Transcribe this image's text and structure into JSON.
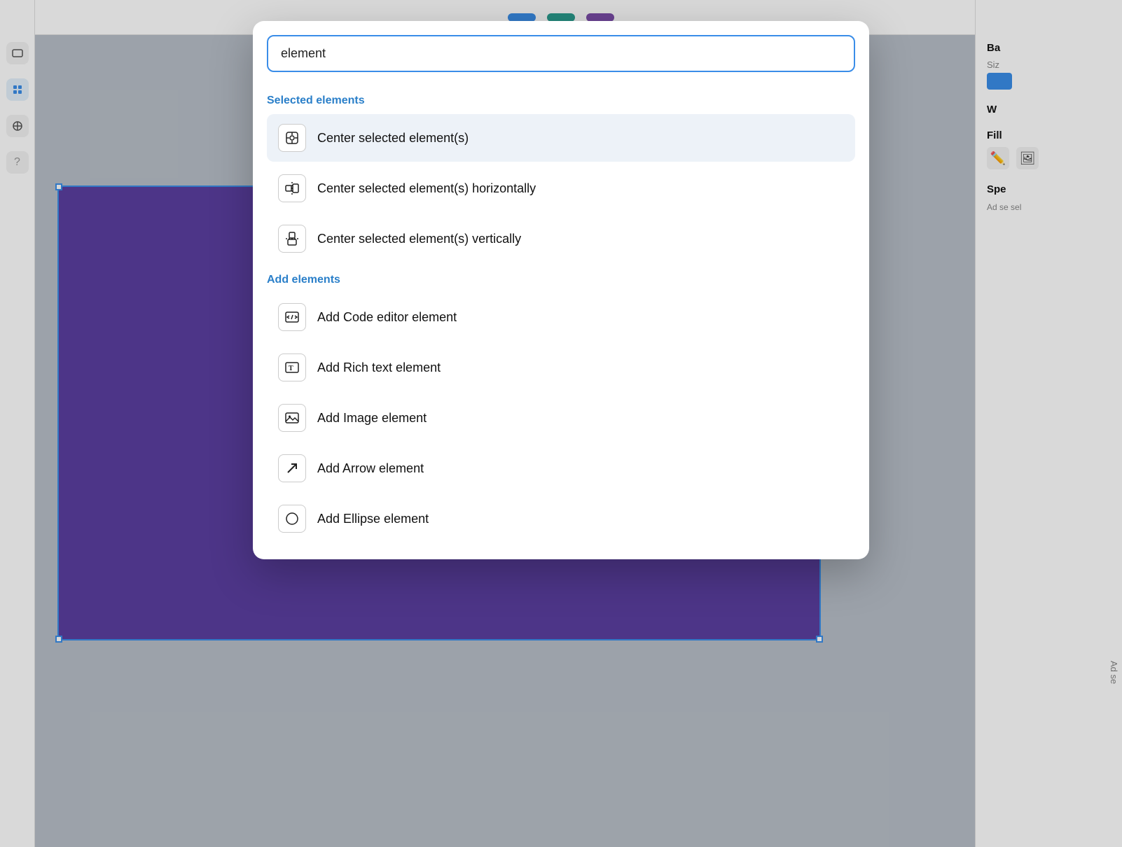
{
  "background": {
    "color": "#b8bfc8"
  },
  "topbar": {
    "buttons": [
      {
        "label": "",
        "style": "blue",
        "name": "top-btn-1"
      },
      {
        "label": "",
        "style": "teal",
        "name": "top-btn-2"
      },
      {
        "label": "",
        "style": "purple",
        "name": "top-btn-3"
      }
    ]
  },
  "rightPanel": {
    "section1": {
      "label": "Ba",
      "sublabel": "Siz"
    },
    "section2": {
      "label": "W"
    },
    "section3": {
      "label": "Fill"
    },
    "section4": {
      "label": "Spe",
      "desc": "Ad se\nsel"
    }
  },
  "modal": {
    "searchPlaceholder": "element",
    "searchValue": "element",
    "sections": [
      {
        "header": "Selected elements",
        "items": [
          {
            "icon": "⊙",
            "label": "Center selected element(s)",
            "active": true,
            "name": "center-selected-elements"
          },
          {
            "icon": "⊟",
            "label": "Center selected element(s) horizontally",
            "active": false,
            "name": "center-selected-elements-horizontally"
          },
          {
            "icon": "⊞",
            "label": "Center selected element(s) vertically",
            "active": false,
            "name": "center-selected-elements-vertically"
          }
        ]
      },
      {
        "header": "Add elements",
        "items": [
          {
            "icon": "⌨",
            "label": "Add Code editor element",
            "active": false,
            "name": "add-code-editor-element"
          },
          {
            "icon": "T",
            "label": "Add Rich text element",
            "active": false,
            "name": "add-rich-text-element"
          },
          {
            "icon": "🖼",
            "label": "Add Image element",
            "active": false,
            "name": "add-image-element"
          },
          {
            "icon": "↗",
            "label": "Add Arrow element",
            "active": false,
            "name": "add-arrow-element"
          },
          {
            "icon": "○",
            "label": "Add Ellipse element",
            "active": false,
            "name": "add-ellipse-element"
          }
        ]
      }
    ]
  },
  "adSe": "Ad se"
}
